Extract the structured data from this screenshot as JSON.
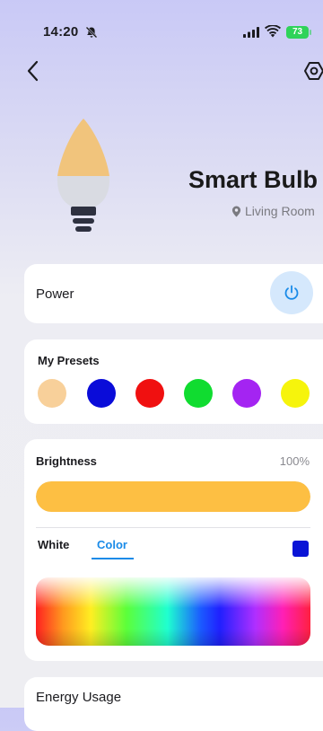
{
  "status_bar": {
    "time": "14:20",
    "battery": "73"
  },
  "device": {
    "name": "Smart Bulb",
    "location": "Living Room"
  },
  "power": {
    "label": "Power",
    "on": true
  },
  "presets": {
    "title": "My Presets",
    "colors": [
      "#f8d09a",
      "#0a0cd9",
      "#f01010",
      "#10dc30",
      "#a424f2",
      "#f6f40c"
    ]
  },
  "brightness": {
    "label": "Brightness",
    "value_text": "100%",
    "value": 100,
    "fill_color": "#fdbf43"
  },
  "color_tabs": {
    "white_label": "White",
    "color_label": "Color",
    "active": "Color",
    "selected_color": "#0a14d6"
  },
  "energy": {
    "label": "Energy Usage"
  },
  "icons": [
    "back-chevron-icon",
    "settings-hexagon-icon",
    "power-icon",
    "location-pin-icon",
    "bell-slash-icon",
    "signal-icon",
    "wifi-icon"
  ]
}
